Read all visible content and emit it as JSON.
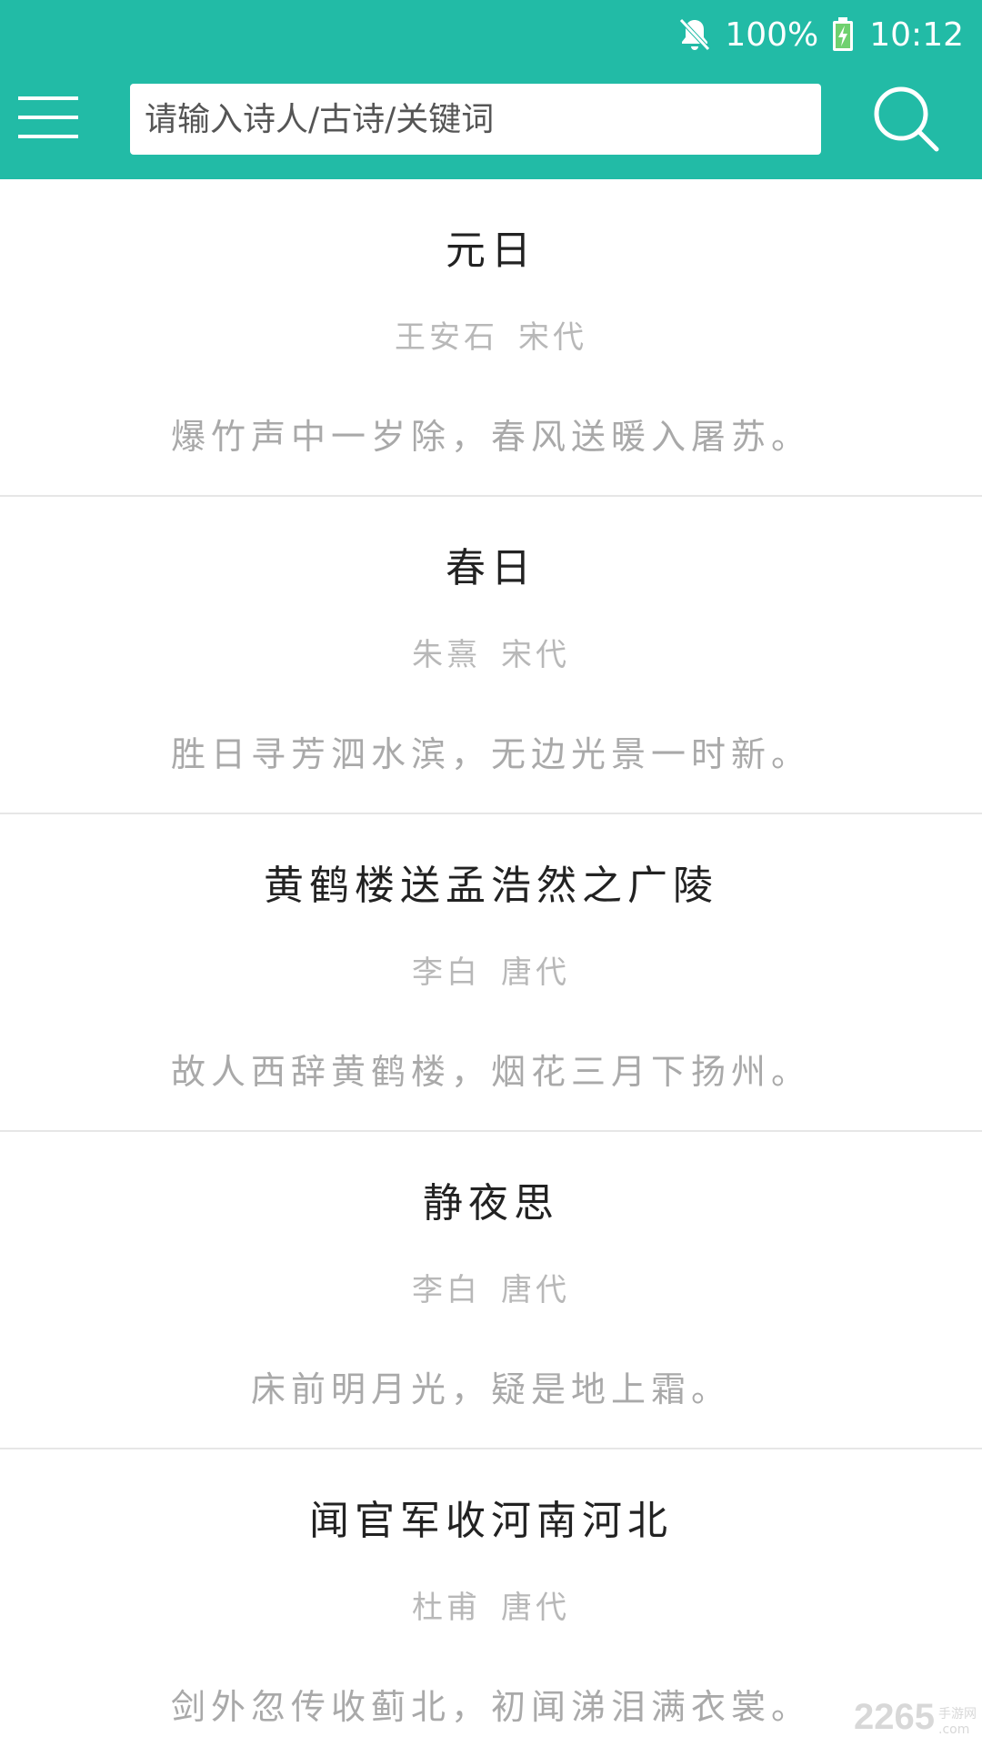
{
  "status_bar": {
    "battery": "100%",
    "time": "10:12",
    "icons": [
      "bell-muted-icon",
      "battery-charging-icon"
    ]
  },
  "header": {
    "menu_icon": "hamburger-menu-icon",
    "search_placeholder": "请输入诗人/古诗/关键词",
    "search_value": "",
    "search_icon": "search-icon"
  },
  "poems": [
    {
      "title": "元日",
      "poet": "王安石",
      "dynasty": "宋代",
      "line": "爆竹声中一岁除，春风送暖入屠苏。"
    },
    {
      "title": "春日",
      "poet": "朱熹",
      "dynasty": "宋代",
      "line": "胜日寻芳泗水滨，无边光景一时新。"
    },
    {
      "title": "黄鹤楼送孟浩然之广陵",
      "poet": "李白",
      "dynasty": "唐代",
      "line": "故人西辞黄鹤楼，烟花三月下扬州。"
    },
    {
      "title": "静夜思",
      "poet": "李白",
      "dynasty": "唐代",
      "line": "床前明月光，疑是地上霜。"
    },
    {
      "title": "闻官军收河南河北",
      "poet": "杜甫",
      "dynasty": "唐代",
      "line": "剑外忽传收蓟北，初闻涕泪满衣裳。"
    }
  ],
  "watermark": {
    "number": "2265",
    "site": "手游网",
    "domain": ".com"
  },
  "colors": {
    "accent": "#22bba6",
    "title_text": "#222222",
    "meta_text": "#b8b8b8",
    "line_text": "#a9a9a9",
    "divider": "#e6e6e6"
  }
}
